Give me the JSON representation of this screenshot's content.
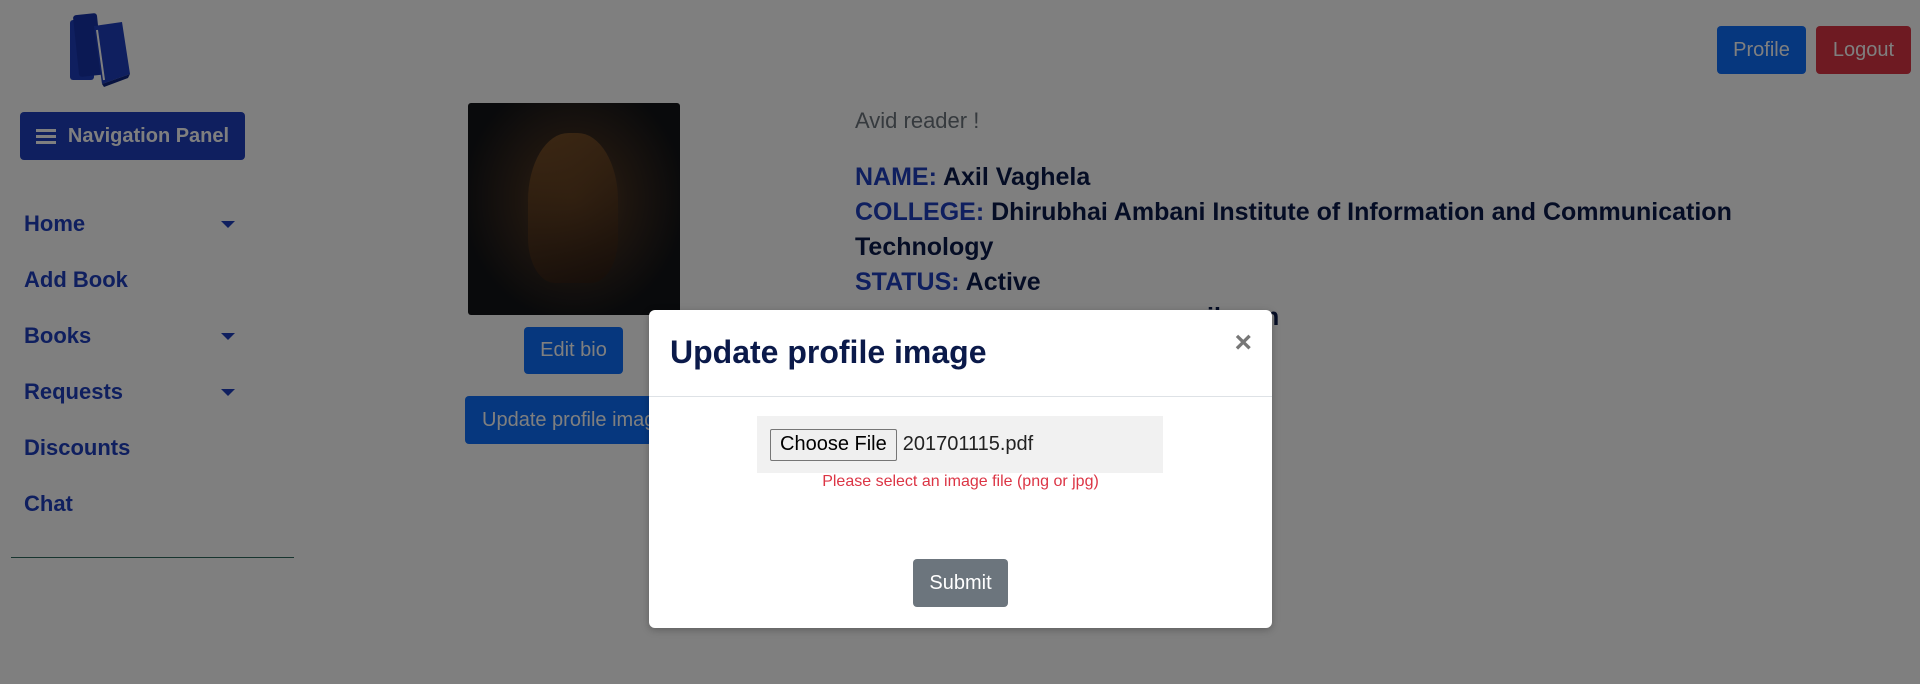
{
  "header": {
    "logo_icon": "books-icon",
    "profile_label": "Profile",
    "logout_label": "Logout"
  },
  "sidebar": {
    "panel_label": "Navigation Panel",
    "items": [
      {
        "label": "Home",
        "has_dropdown": true
      },
      {
        "label": "Add Book",
        "has_dropdown": false
      },
      {
        "label": "Books",
        "has_dropdown": true
      },
      {
        "label": "Requests",
        "has_dropdown": true
      },
      {
        "label": "Discounts",
        "has_dropdown": false
      },
      {
        "label": "Chat",
        "has_dropdown": false
      }
    ]
  },
  "profile": {
    "bio": "Avid reader !",
    "edit_bio_label": "Edit bio",
    "update_image_label": "Update profile image",
    "fields": {
      "name_key": "NAME:",
      "name_value": "Axil Vaghela",
      "college_key": "COLLEGE:",
      "college_value": "Dhirubhai Ambani Institute of Information and Communication Technology",
      "status_key": "STATUS:",
      "status_value": "Active",
      "email_visible_fragment": "il.com"
    }
  },
  "modal": {
    "title": "Update profile image",
    "close_symbol": "×",
    "choose_file_label": "Choose File",
    "file_name": "201701115.pdf",
    "error_text": "Please select an image file (png or jpg)",
    "submit_label": "Submit"
  },
  "colors": {
    "primary": "#0d6efd",
    "danger": "#dc3545",
    "nav_blue": "#1f3fbf",
    "secondary": "#6c757d"
  }
}
